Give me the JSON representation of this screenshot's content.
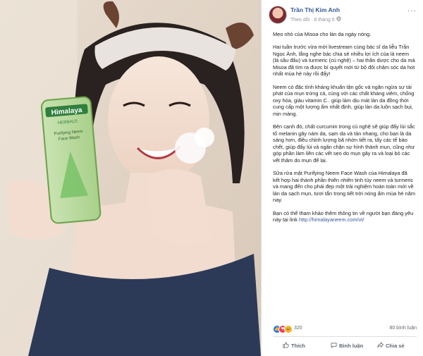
{
  "post": {
    "author": "Trần Thị Kim Anh",
    "follow_label": "Theo dõi",
    "separator": "·",
    "date": "8 tháng 5",
    "globe_icon": "globe-icon",
    "more_icon": "···",
    "paragraphs": [
      "Mẹo nhỏ của Misoa cho làn da ngày nóng.",
      "Hai tuần trước vừa mới livestream cùng bác sĩ da liễu Trần Ngọc Ánh, lắng nghe bác chia sẻ nhiều lợi ích của lá neem (lá sầu đâu) và turmeric (củ nghệ) – hai thần dược cho da mà Misoa đã tìm ra được bí quyết mới từ bộ đôi chăm sóc da hot nhất mùa hè này rồi đấy!",
      "Neem có đặc tính kháng khuẩn tận gốc và ngăn ngừa sự tái phát của mụn trứng cá, cùng với các chất kháng viêm, chống oxy hóa, giàu vitamin C.. giúp làm dịu mát làn da đồng thời cung cấp một lượng ẩm nhất định, giúp làn da luôn sạch bụi, mịn màng.",
      "Bên cạnh đó, chất curcumin trong củ nghệ sẽ giúp đẩy lùi sắc tố melanin gây nám da, sạm da và tàn nhang, cho bạn là da sáng hơn, điều chỉnh lượng bã nhờn tiết ra, tẩy các tế bào chết, giúp đẩy lùi và ngăn chặn sự hình thành mụn, cũng như góp phần làm liền các vết sẹo do mụn gây ra và loại bỏ các vết thâm do mụn để lại.",
      "Sữa rửa mặt Purifying Neem Face Wash của Himalaya đã kết hợp hai thành phần thiên nhiên tinh túy neem và turmeric và mang đến cho phái đẹp một trải nghiệm hoàn toàn mới về làn da sạch mụn, tươi tắn trong tiết trời nóng ẩm mùa hè năm nay."
    ],
    "last_paragraph_text": "Bạn có thể tham khảo thêm thông tin về người bạn đáng yêu này tại link ",
    "link_text": "http://himalayaneem.com/vt/",
    "reaction_count": "320",
    "comments_count": "80 bình luận",
    "actions": {
      "like": "Thích",
      "comment": "Bình luận",
      "share": "Chia sẻ"
    }
  },
  "photo": {
    "product_brand": "Himalaya",
    "product_sub": "HERBALS",
    "product_line1": "Purifying Neem",
    "product_line2": "Face Wash"
  },
  "colors": {
    "link": "#385898",
    "author": "#365899",
    "muted": "#606770"
  }
}
